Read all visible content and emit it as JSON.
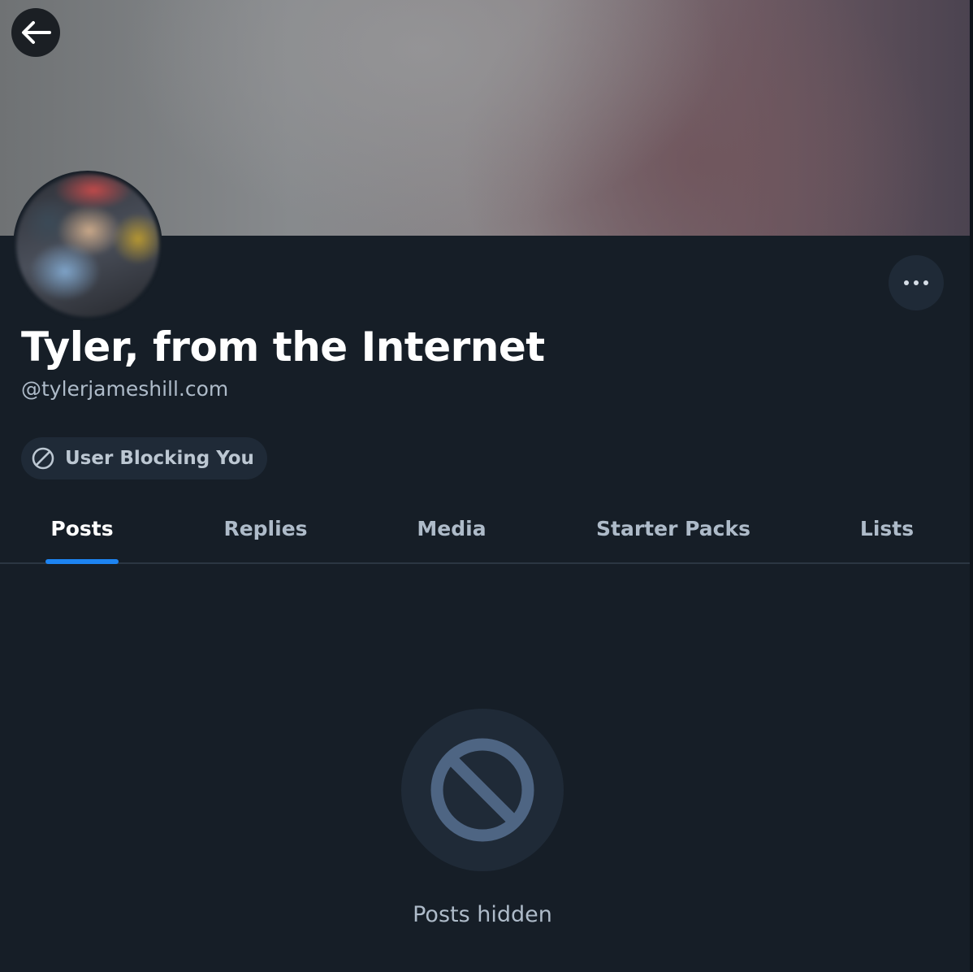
{
  "profile": {
    "display_name": "Tyler, from the Internet",
    "handle": "@tylerjameshill.com",
    "status_badge": "User Blocking You"
  },
  "header": {
    "back_icon": "arrow-left-icon",
    "more_icon": "ellipsis-icon"
  },
  "tabs": [
    {
      "label": "Posts",
      "active": true
    },
    {
      "label": "Replies",
      "active": false
    },
    {
      "label": "Media",
      "active": false
    },
    {
      "label": "Starter Packs",
      "active": false
    },
    {
      "label": "Lists",
      "active": false
    }
  ],
  "empty_state": {
    "icon": "prohibited-icon",
    "message": "Posts hidden"
  },
  "colors": {
    "background": "#161e27",
    "accent": "#1d84f2",
    "muted_text": "#aebbc9",
    "pill_bg": "#1f2a37"
  }
}
